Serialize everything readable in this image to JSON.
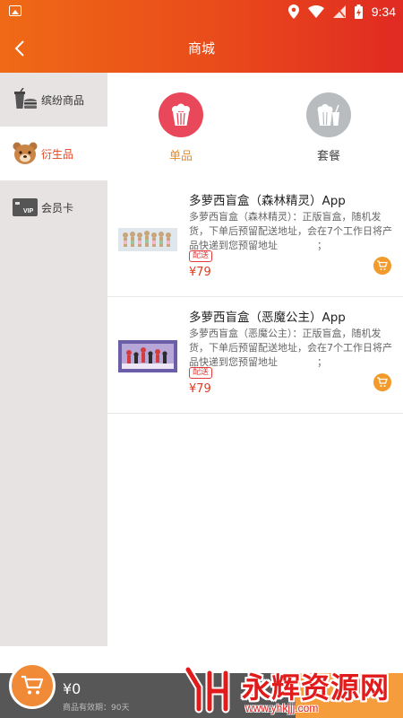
{
  "status_bar": {
    "time": "9:34"
  },
  "header": {
    "title": "商城"
  },
  "sidebar": {
    "items": [
      {
        "label": "缤纷商品",
        "icon": "snack-drink-icon",
        "active": false
      },
      {
        "label": "衍生品",
        "icon": "bear-icon",
        "active": true
      },
      {
        "label": "会员卡",
        "icon": "vip-card-icon",
        "active": false
      }
    ]
  },
  "categories": [
    {
      "label": "单品",
      "icon": "popcorn-icon",
      "active": true,
      "color": "#e8485a"
    },
    {
      "label": "套餐",
      "icon": "popcorn-drink-icon",
      "active": false,
      "color": "#b8bcbf"
    }
  ],
  "products": [
    {
      "title": "多萝西盲盒（森林精灵）App",
      "description": "多萝西盲盒（森林精灵）：正版盲盒，随机发货，下单后预留配送地址，会在7个工作日将产品快递到您预留地址　　　　；",
      "tag": "配送",
      "price": "¥79"
    },
    {
      "title": "多萝西盲盒（恶魔公主）App",
      "description": "多萝西盲盒（恶魔公主）：正版盲盒，随机发货，下单后预留配送地址，会在7个工作日将产品快递到您预留地址　　　　；",
      "tag": "配送",
      "price": "¥79"
    }
  ],
  "bottom_bar": {
    "total": "¥0",
    "validity": "商品有效期：90天"
  },
  "watermark": {
    "name": "永辉资源网",
    "url": "www.yhkjjj.com"
  },
  "colors": {
    "header_start": "#ef6a16",
    "header_end": "#e02a22",
    "accent_orange": "#f39a2c",
    "price_red": "#e03a1e",
    "sidebar_bg": "#e7e3e3"
  }
}
